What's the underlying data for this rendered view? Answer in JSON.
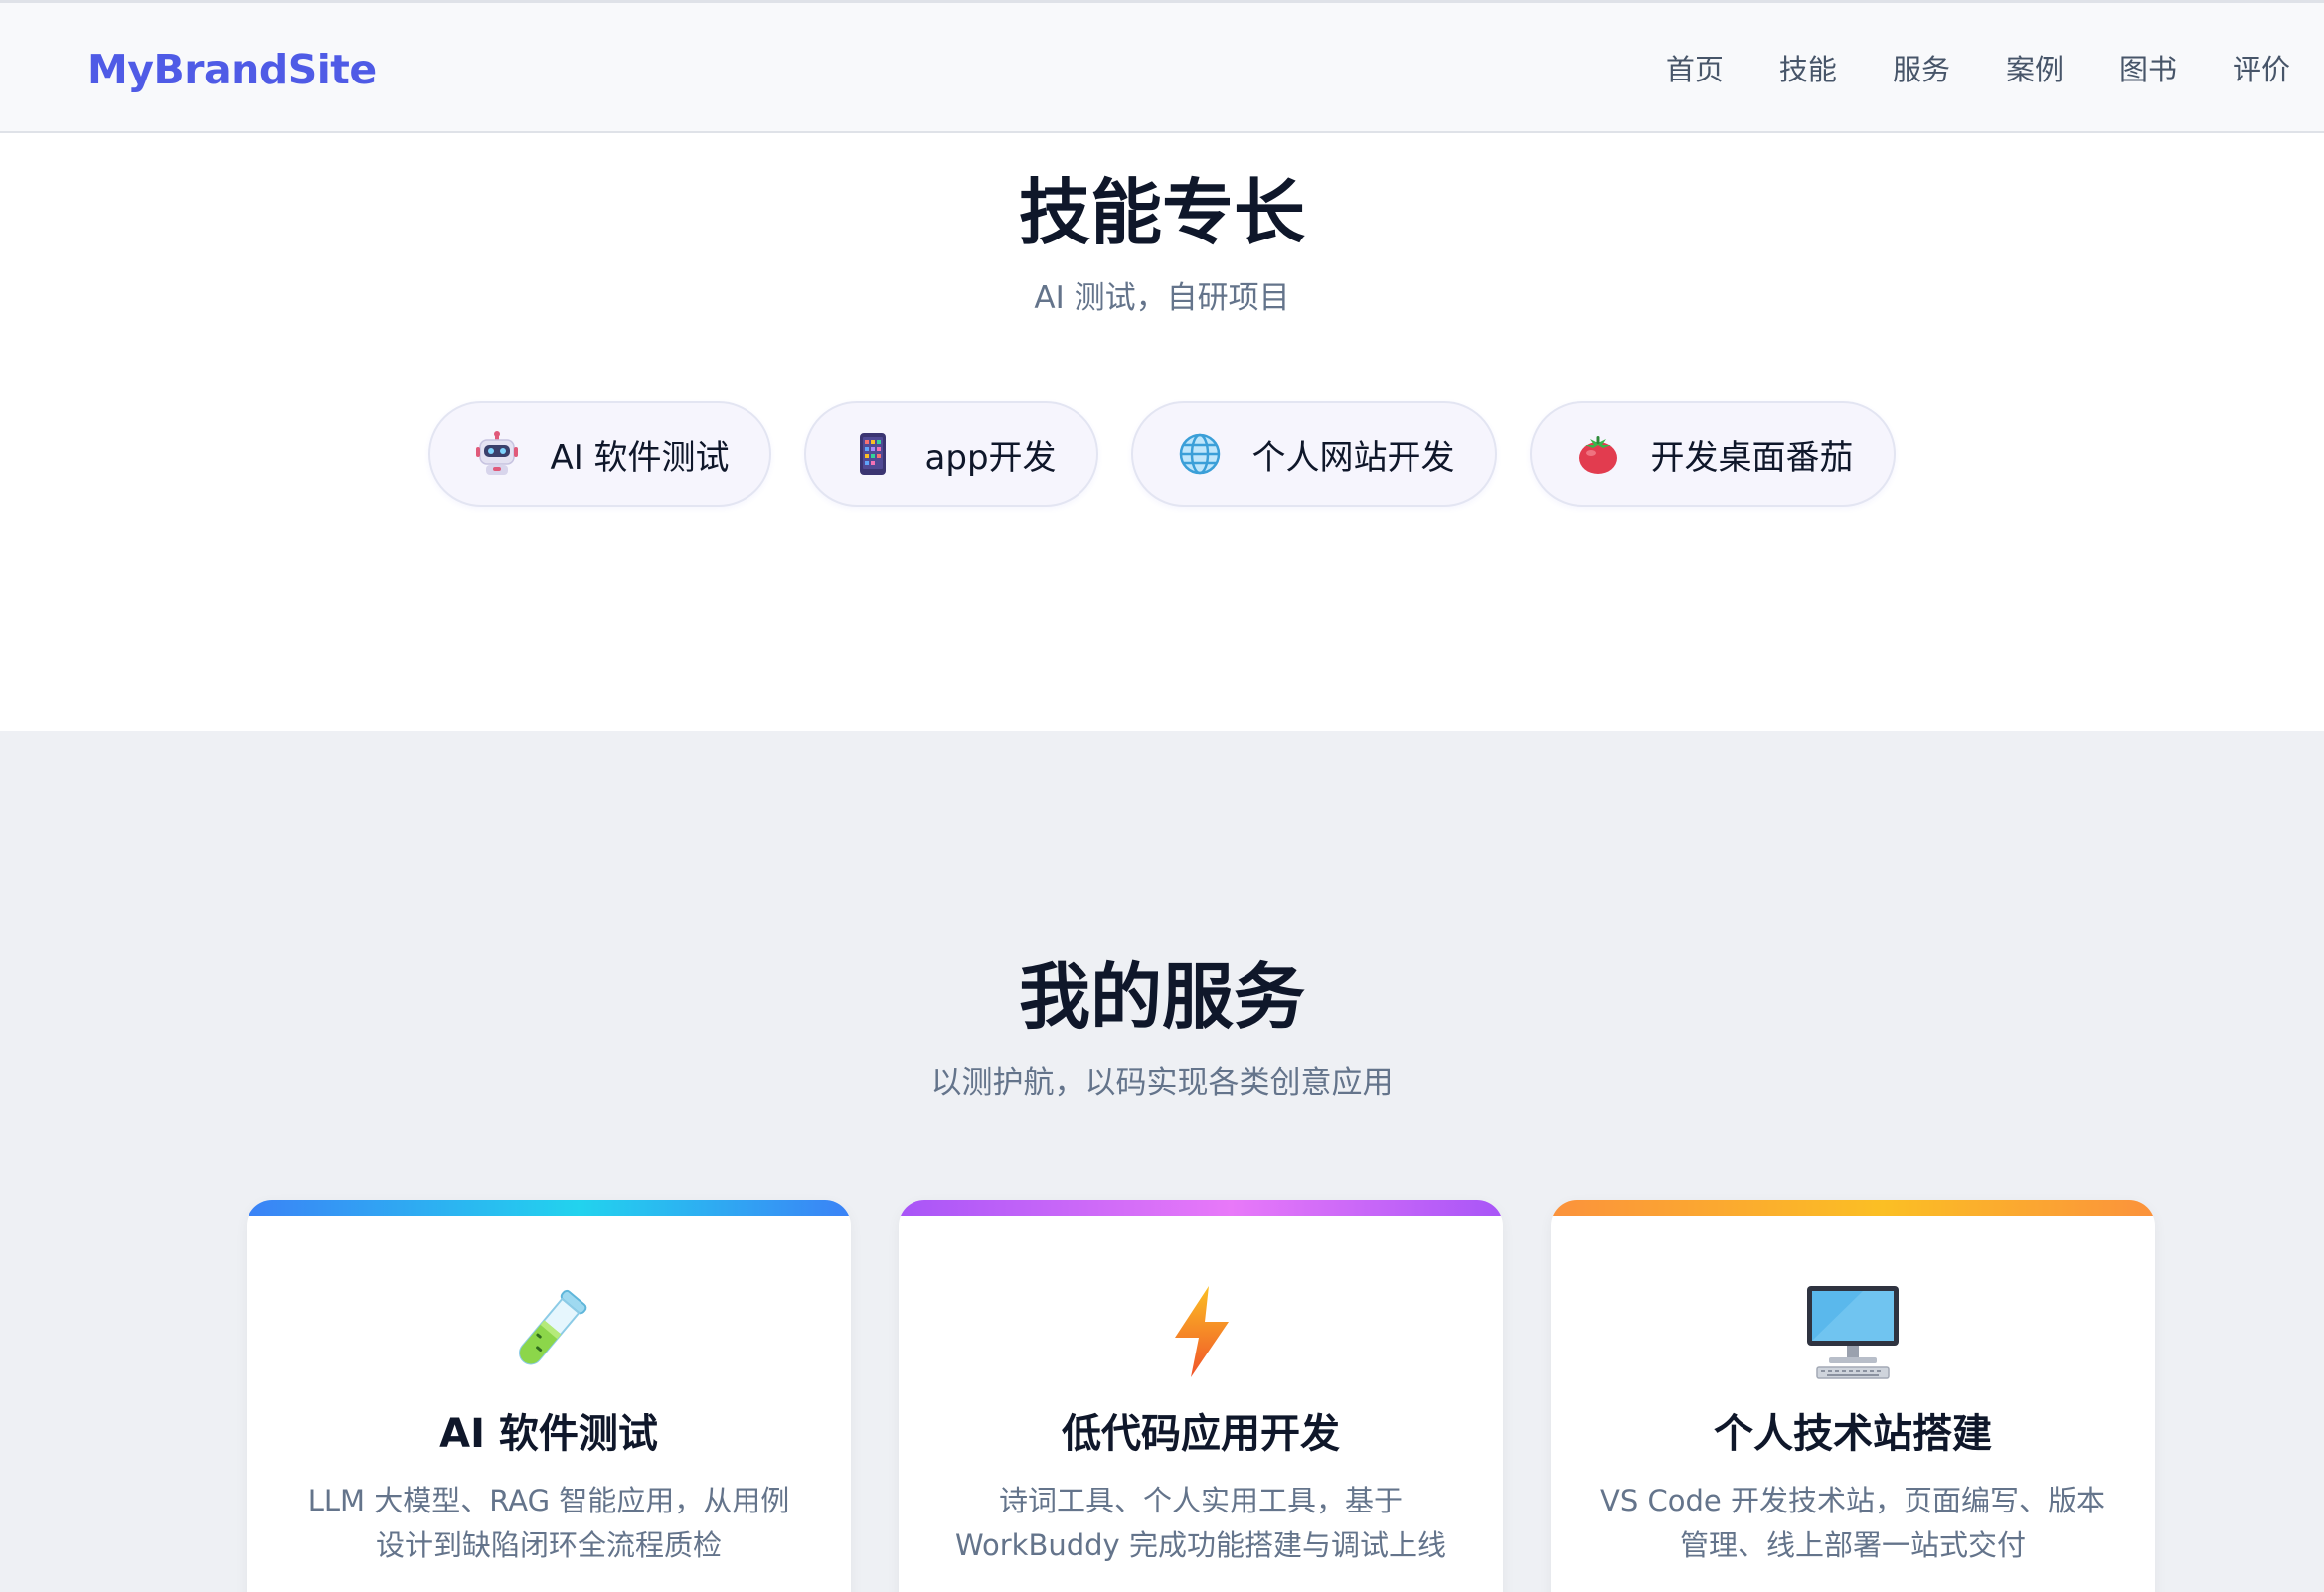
{
  "nav": {
    "brand": "MyBrandSite",
    "links": [
      "首页",
      "技能",
      "服务",
      "案例",
      "图书",
      "评价"
    ]
  },
  "skills": {
    "title": "技能专长",
    "subtitle": "AI 测试，自研项目",
    "chips": [
      {
        "label": "AI 软件测试",
        "icon": "robot-icon"
      },
      {
        "label": "app开发",
        "icon": "phone-icon"
      },
      {
        "label": "个人网站开发",
        "icon": "globe-icon"
      },
      {
        "label": "开发桌面番茄",
        "icon": "tomato-icon"
      }
    ]
  },
  "services": {
    "title": "我的服务",
    "subtitle": "以测护航，以码实现各类创意应用",
    "cards": [
      {
        "title": "AI 软件测试",
        "desc": "LLM 大模型、RAG 智能应用，从用例设计到缺陷闭环全流程质检",
        "icon": "test-tube-icon",
        "accent": [
          "#3b82f6",
          "#22d3ee"
        ]
      },
      {
        "title": "低代码应用开发",
        "desc": "诗词工具、个人实用工具，基于 WorkBuddy 完成功能搭建与调试上线",
        "icon": "lightning-icon",
        "accent": [
          "#a855f7",
          "#e879f9"
        ]
      },
      {
        "title": "个人技术站搭建",
        "desc": "VS Code 开发技术站，页面编写、版本管理、线上部署一站式交付",
        "icon": "desktop-computer-icon",
        "accent": [
          "#fb923c",
          "#fbbf24"
        ]
      }
    ]
  },
  "colors": {
    "brand": "#4f5be6",
    "heading": "#0f172a",
    "muted": "#64748b",
    "services_bg": "#eef0f4"
  }
}
